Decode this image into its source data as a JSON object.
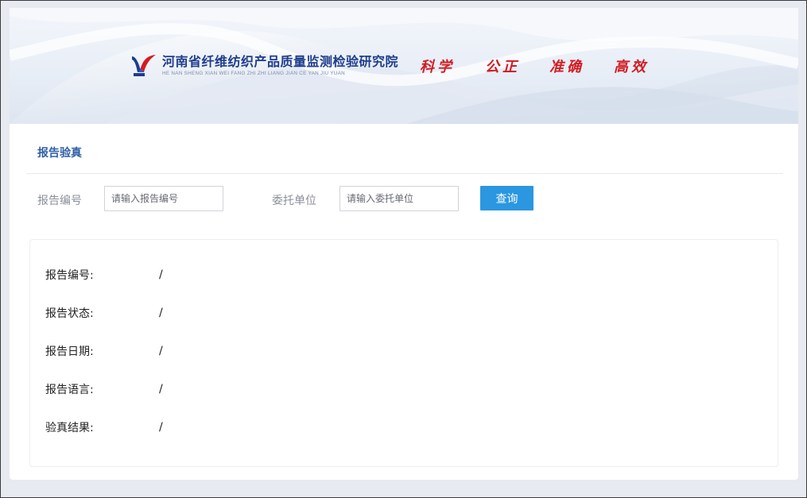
{
  "banner": {
    "org_name": "河南省纤维纺织产品质量监测检验研究院",
    "org_pinyin": "HE NAN SHENG XIAN WEI FANG ZHI ZHI LIANG JIAN CE YAN JIU YUAN",
    "slogans": [
      "科学",
      "公正",
      "准确",
      "高效"
    ],
    "logo_icon": "institute-logo-icon"
  },
  "section": {
    "title": "报告验真"
  },
  "search": {
    "report_no_label": "报告编号",
    "report_no_placeholder": "请输入报告编号",
    "report_no_value": "",
    "client_label": "委托单位",
    "client_placeholder": "请输入委托单位",
    "client_value": "",
    "query_button": "查询"
  },
  "result": {
    "rows": [
      {
        "label": "报告编号:",
        "value": "/"
      },
      {
        "label": "报告状态:",
        "value": "/"
      },
      {
        "label": "报告日期:",
        "value": "/"
      },
      {
        "label": "报告语言:",
        "value": "/"
      },
      {
        "label": "验真结果:",
        "value": "/"
      }
    ]
  },
  "colors": {
    "accent": "#2a97e0",
    "title": "#2f5fa7",
    "slogan": "#d41b22",
    "brand": "#1e3d8c"
  }
}
